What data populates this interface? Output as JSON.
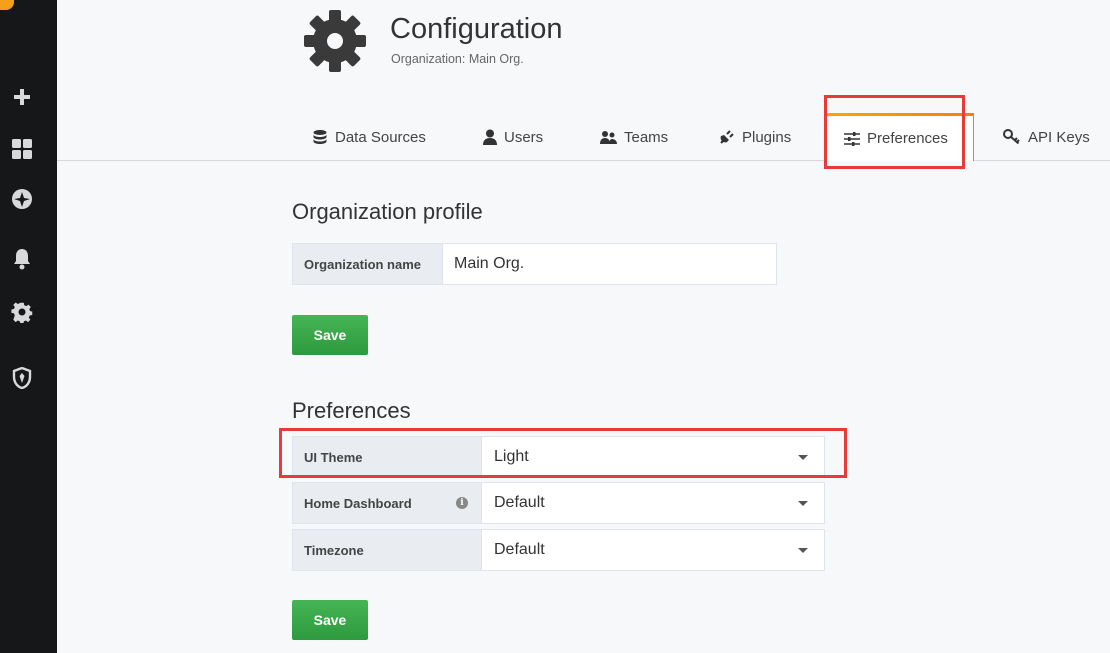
{
  "header": {
    "title": "Configuration",
    "subtitle": "Organization: Main Org."
  },
  "tabs": [
    {
      "label": "Data Sources",
      "icon": "database-icon"
    },
    {
      "label": "Users",
      "icon": "user-icon"
    },
    {
      "label": "Teams",
      "icon": "team-icon"
    },
    {
      "label": "Plugins",
      "icon": "plug-icon"
    },
    {
      "label": "Preferences",
      "icon": "sliders-icon",
      "active": true
    },
    {
      "label": "API Keys",
      "icon": "key-icon"
    }
  ],
  "sidebar": {
    "icons": [
      "plus-icon",
      "dashboards-icon",
      "explore-icon",
      "alerting-icon",
      "configuration-icon",
      "shield-icon"
    ]
  },
  "org_profile": {
    "title": "Organization profile",
    "name_label": "Organization name",
    "name_value": "Main Org.",
    "save_label": "Save"
  },
  "preferences": {
    "title": "Preferences",
    "ui_theme_label": "UI Theme",
    "ui_theme_value": "Light",
    "home_dashboard_label": "Home Dashboard",
    "home_dashboard_value": "Default",
    "timezone_label": "Timezone",
    "timezone_value": "Default",
    "save_label": "Save"
  },
  "colors": {
    "sidebar_bg": "#161719",
    "save_button": "#3aa74a",
    "highlight_box": "#e83a37",
    "active_tab_accent": "#ff9900"
  }
}
